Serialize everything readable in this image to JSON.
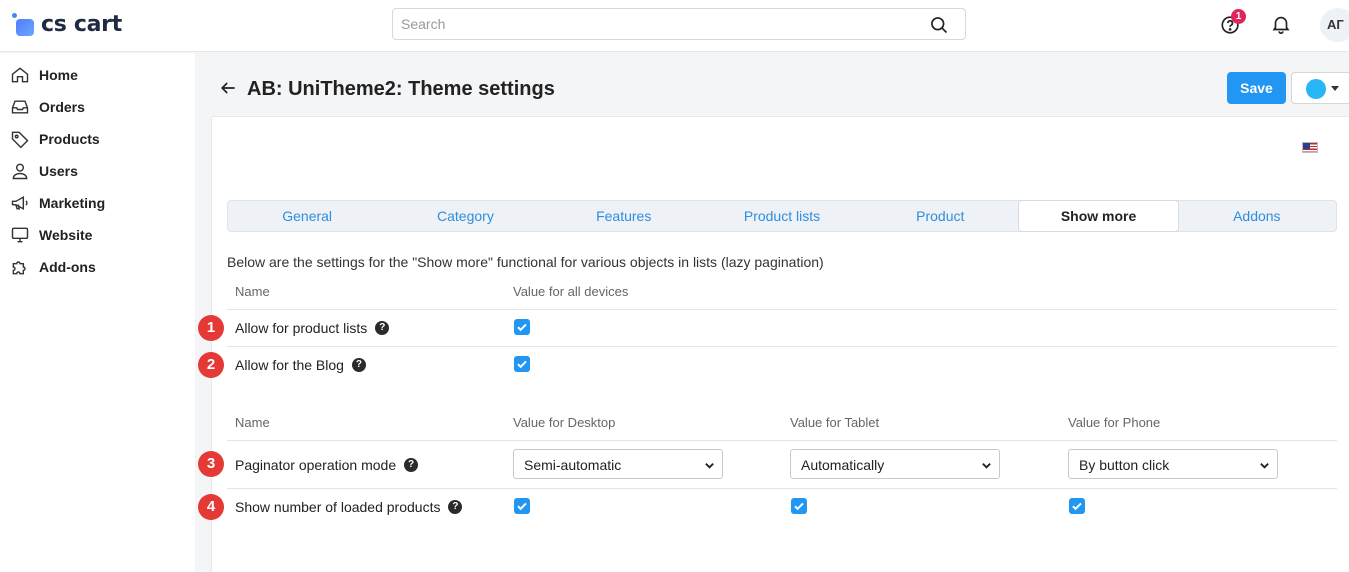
{
  "brand": {
    "name": "cs cart"
  },
  "search": {
    "placeholder": "Search"
  },
  "header": {
    "notification_count": "1",
    "avatar_initials": "АГ"
  },
  "sidebar": {
    "items": [
      {
        "label": "Home",
        "icon": "home-icon"
      },
      {
        "label": "Orders",
        "icon": "inbox-icon"
      },
      {
        "label": "Products",
        "icon": "tag-icon"
      },
      {
        "label": "Users",
        "icon": "user-icon"
      },
      {
        "label": "Marketing",
        "icon": "megaphone-icon"
      },
      {
        "label": "Website",
        "icon": "monitor-icon"
      },
      {
        "label": "Add-ons",
        "icon": "puzzle-icon"
      }
    ]
  },
  "page": {
    "title": "AB: UniTheme2: Theme settings",
    "save_label": "Save",
    "description": "Below are the settings for the \"Show more\" functional for various objects in lists (lazy pagination)"
  },
  "tabs": [
    {
      "label": "General",
      "active": false
    },
    {
      "label": "Category",
      "active": false
    },
    {
      "label": "Features",
      "active": false
    },
    {
      "label": "Product lists",
      "active": false
    },
    {
      "label": "Product",
      "active": false
    },
    {
      "label": "Show more",
      "active": true
    },
    {
      "label": "Addons",
      "active": false
    }
  ],
  "section1": {
    "headers": {
      "name": "Name",
      "value": "Value for all devices"
    },
    "rows": [
      {
        "num": "1",
        "label": "Allow for product lists",
        "checked": true
      },
      {
        "num": "2",
        "label": "Allow for the Blog",
        "checked": true
      }
    ]
  },
  "section2": {
    "headers": {
      "name": "Name",
      "desktop": "Value for Desktop",
      "tablet": "Value for Tablet",
      "phone": "Value for Phone"
    },
    "rows": [
      {
        "num": "3",
        "label": "Paginator operation mode",
        "desktop": "Semi-automatic",
        "tablet": "Automatically",
        "phone": "By button click"
      },
      {
        "num": "4",
        "label": "Show number of loaded products",
        "desktop_checked": true,
        "tablet_checked": true,
        "phone_checked": true
      }
    ]
  },
  "colors": {
    "accent": "#2196f3",
    "link": "#2f8dde",
    "marker": "#e53935"
  }
}
